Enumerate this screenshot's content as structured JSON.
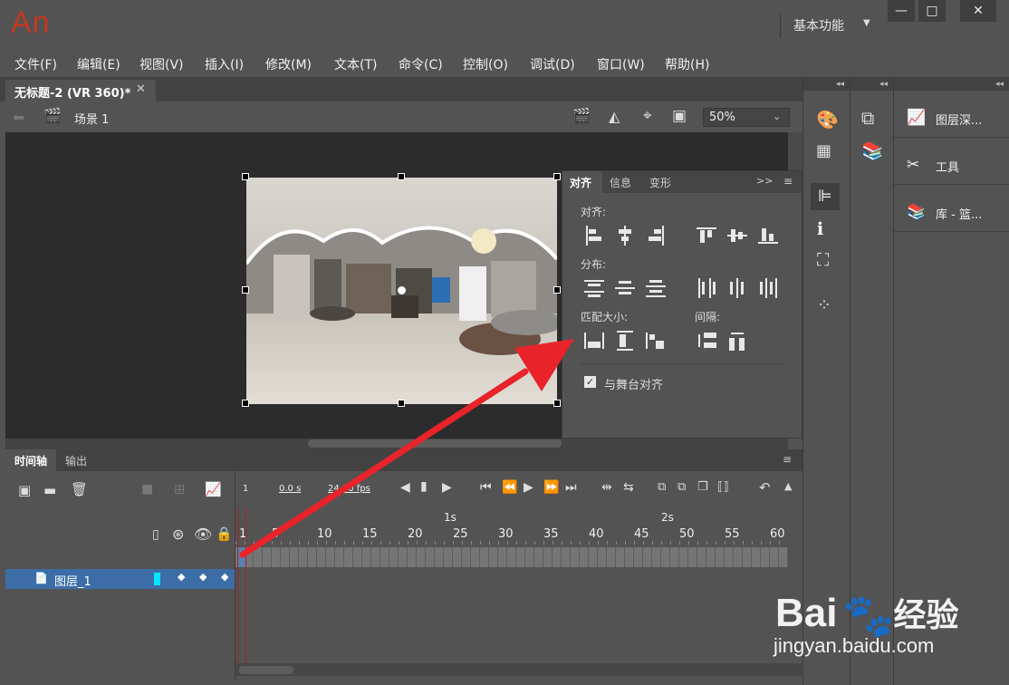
{
  "app": {
    "logo": "An",
    "workspace": "基本功能"
  },
  "menu": [
    "文件(F)",
    "编辑(E)",
    "视图(V)",
    "插入(I)",
    "修改(M)",
    "文本(T)",
    "命令(C)",
    "控制(O)",
    "调试(D)",
    "窗口(W)",
    "帮助(H)"
  ],
  "document": {
    "tab": "无标题-2 (VR 360)*",
    "scene": "场景 1",
    "zoom": "50%"
  },
  "align_panel": {
    "tabs": [
      "对齐",
      "信息",
      "变形"
    ],
    "align_label": "对齐:",
    "distribute_label": "分布:",
    "match_size_label": "匹配大小:",
    "space_label": "间隔:",
    "stage_align_label": "与舞台对齐",
    "stage_align_checked": true
  },
  "right_dock": {
    "panels": [
      "图层深...",
      "工具",
      "库 - 篮..."
    ]
  },
  "timeline": {
    "tabs": [
      "时间轴",
      "输出"
    ],
    "frame": "1",
    "time": "0.0 s",
    "fps": "24.00 fps",
    "layer_name": "图层_1",
    "ruler_secs": [
      "1s",
      "2s"
    ],
    "ruler_ticks": [
      "1",
      "5",
      "10",
      "15",
      "20",
      "25",
      "30",
      "35",
      "40",
      "45",
      "50",
      "55",
      "60"
    ]
  },
  "watermark": {
    "brand": "Bai",
    "brand2": "经验",
    "url": "jingyan.baidu.com"
  },
  "colors": {
    "accent": "#c23a21",
    "selection": "#3c6da6",
    "arrow": "#e8232a"
  }
}
